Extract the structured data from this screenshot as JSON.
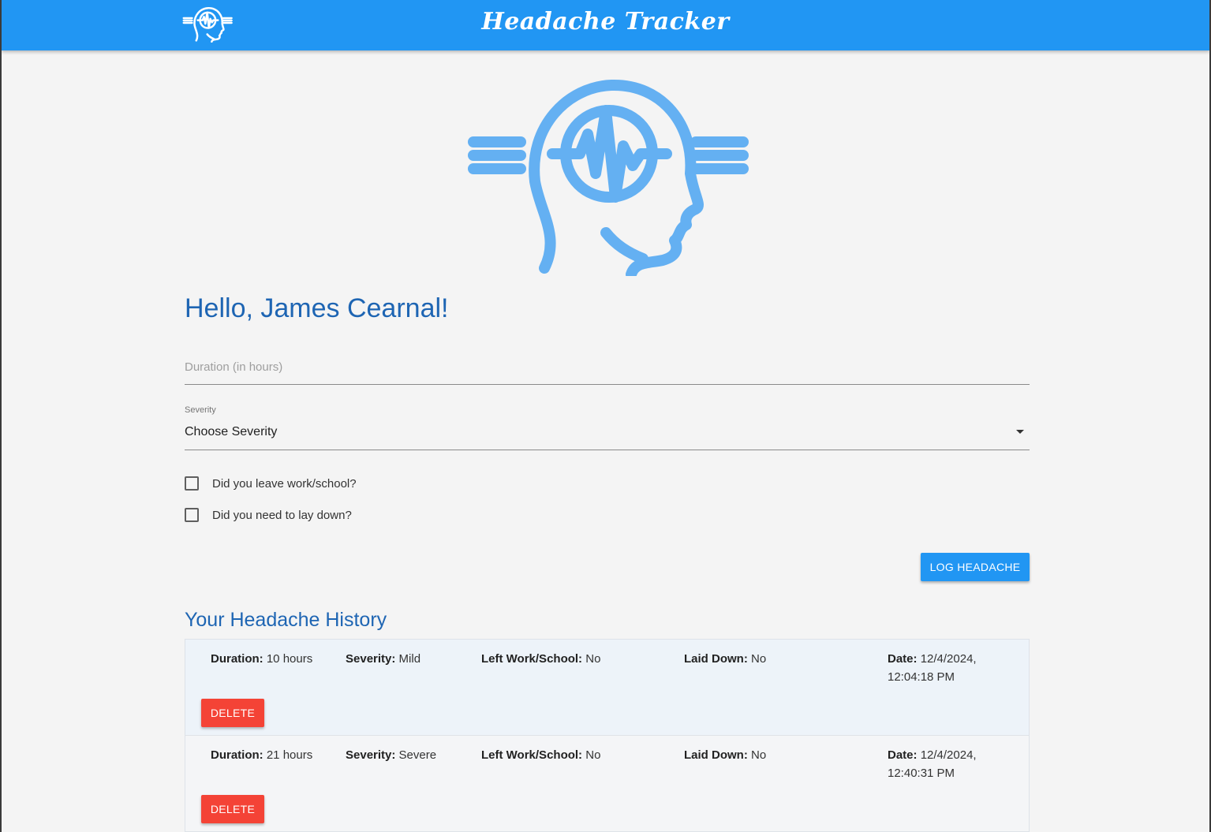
{
  "app": {
    "title": "Headache Tracker",
    "brand_color": "#2196f3",
    "logo_icon": "head-pulse-logo"
  },
  "greeting": "Hello, James Cearnal!",
  "form": {
    "duration_placeholder": "Duration (in hours)",
    "duration_value": "",
    "severity_label": "Severity",
    "severity_value": "Choose Severity",
    "checkboxes": [
      {
        "label": "Did you leave work/school?",
        "checked": false
      },
      {
        "label": "Did you need to lay down?",
        "checked": false
      }
    ],
    "submit_label": "LOG HEADACHE"
  },
  "history": {
    "title": "Your Headache History",
    "labels": {
      "duration": "Duration:",
      "severity": "Severity:",
      "left_work": "Left Work/School:",
      "laid_down": "Laid Down:",
      "date": "Date:"
    },
    "delete_label": "DELETE",
    "delete_color": "#f44336",
    "entries": [
      {
        "duration": "10 hours",
        "severity": "Mild",
        "left_work": "No",
        "laid_down": "No",
        "date": "12/4/2024,",
        "time": "12:04:18 PM"
      },
      {
        "duration": "21 hours",
        "severity": "Severe",
        "left_work": "No",
        "laid_down": "No",
        "date": "12/4/2024,",
        "time": "12:40:31 PM"
      }
    ]
  }
}
